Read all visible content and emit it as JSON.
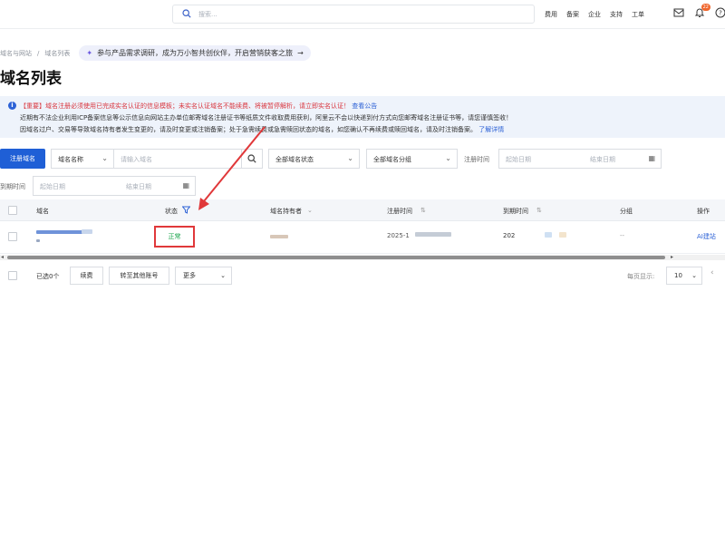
{
  "topbar": {
    "search_placeholder": "搜索...",
    "nav": [
      "费用",
      "备案",
      "企业",
      "支持",
      "工单"
    ],
    "notification_count": "22"
  },
  "breadcrumb": {
    "items": [
      "域名与网站",
      "域名列表"
    ],
    "promo": "参与产品需求调研，成为万小智共创伙伴，开启营销获客之旅"
  },
  "page_title": "域名列表",
  "notice": {
    "line1_important": "【重要】域名注册必须使用已完成实名认证的信息模板；未实名认证域名不能续费、将被暂停解析，请立即实名认证！",
    "line1_link": "查看公告",
    "line2": "近期有不法企业利用ICP备案信息等公示信息向网站主办单位邮寄域名注册证书等纸质文件收取费用获利，阿里云不会以快递到付方式向您邮寄域名注册证书等，请您谨慎签收！",
    "line3": "因域名过户、交易等导致域名持有者发生变更的，请及时变更或注销备案；处于急需续费或急需赎回状态的域名，如您确认不再续费或赎回域名，请及时注销备案。",
    "line3_link": "了解详情"
  },
  "toolbar": {
    "register_button": "注册域名",
    "domain_name_select": "域名名称",
    "domain_input_placeholder": "请输入域名",
    "status_select": "全部域名状态",
    "group_select": "全部域名分组",
    "reg_time_label": "注册时间",
    "start_date": "起始日期",
    "end_date": "结束日期",
    "expire_time_label": "到期时间"
  },
  "table": {
    "headers": {
      "domain": "域名",
      "status": "状态",
      "holder": "域名持有者",
      "reg_time": "注册时间",
      "expire_time": "到期时间",
      "group": "分组",
      "action": "操作"
    },
    "rows": [
      {
        "status": "正常",
        "reg_time": "2025-1",
        "expire_time": "202",
        "group": "--",
        "action": "AI建站"
      }
    ]
  },
  "footer": {
    "selected": "已选0个",
    "renew": "续费",
    "transfer": "转至其他账号",
    "more": "更多",
    "per_page_label": "每页显示:",
    "per_page": "10"
  },
  "colors": {
    "primary": "#1f5fd6",
    "highlight": "#e0383a",
    "status_ok": "#17a34a",
    "notice_bg": "#eef3fb"
  }
}
